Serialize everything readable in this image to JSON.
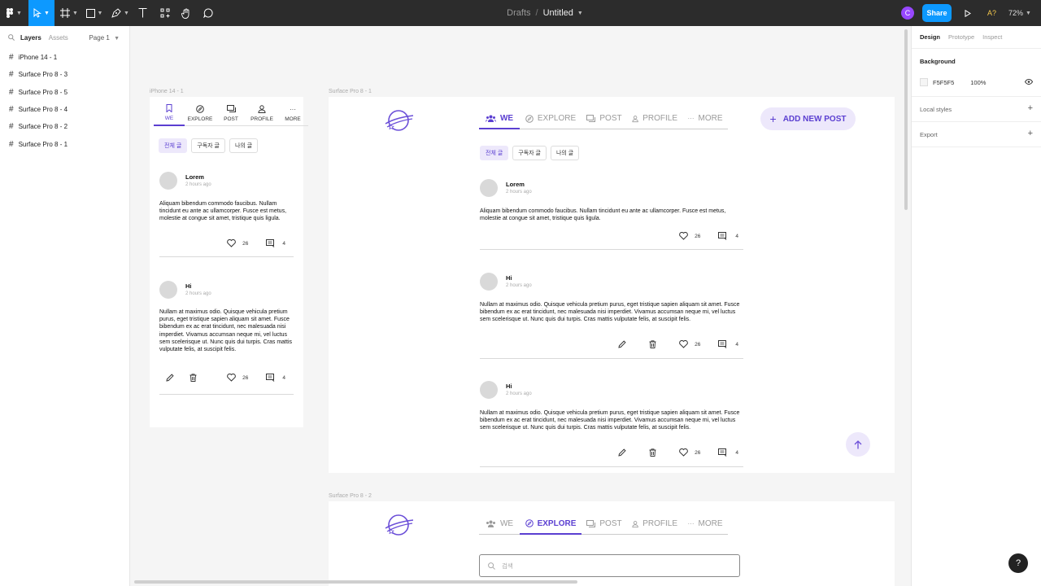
{
  "toolbar": {
    "breadcrumb_root": "Drafts",
    "breadcrumb_sep": "/",
    "file_name": "Untitled",
    "avatar_letter": "C",
    "share_label": "Share",
    "aa_label": "A?",
    "zoom_label": "72%"
  },
  "left_panel": {
    "tab_layers": "Layers",
    "tab_assets": "Assets",
    "page_selector": "Page 1",
    "layers": [
      "iPhone 14 - 1",
      "Surface Pro 8 - 3",
      "Surface Pro 8 - 5",
      "Surface Pro 8 - 4",
      "Surface Pro 8 - 2",
      "Surface Pro 8 - 1"
    ]
  },
  "right_panel": {
    "tab_design": "Design",
    "tab_prototype": "Prototype",
    "tab_inspect": "Inspect",
    "background_title": "Background",
    "background_hex": "F5F5F5",
    "background_opacity": "100%",
    "local_styles": "Local styles",
    "export": "Export"
  },
  "frames": {
    "iphone_label": "iPhone 14 - 1",
    "surface1_label": "Surface Pro 8 - 1",
    "surface2_label": "Surface Pro 8 - 2"
  },
  "nav": {
    "we": "WE",
    "explore": "EXPLORE",
    "post": "POST",
    "profile": "PROFILE",
    "more": "MORE",
    "more_dots": "···"
  },
  "chips": {
    "all": "전체 글",
    "subscribed": "구독자 글",
    "mine": "나의 글"
  },
  "add_post_label": "ADD NEW POST",
  "search_placeholder": "검색",
  "posts": [
    {
      "name": "Lorem",
      "time": "2 hours ago",
      "body": "Aliquam bibendum commodo faucibus. Nullam tincidunt eu ante ac ullamcorper. Fusce est metus, molestie at congue sit amet, tristique quis ligula.",
      "likes": "26",
      "comments": "4"
    },
    {
      "name": "Hi",
      "time": "2 hours ago",
      "body": "Nullam at maximus odio. Quisque vehicula pretium purus, eget tristique sapien aliquam sit amet. Fusce bibendum ex ac erat tincidunt, nec malesuada nisi imperdiet. Vivamus accumsan neque mi, vel luctus sem scelerisque ut. Nunc quis dui turpis. Cras mattis vulputate felis, at suscipit felis.",
      "likes": "26",
      "comments": "4"
    },
    {
      "name": "Hi",
      "time": "2 hours ago",
      "body": "Nullam at maximus odio. Quisque vehicula pretium purus, eget tristique sapien aliquam sit amet. Fusce bibendum ex ac erat tincidunt, nec malesuada nisi imperdiet. Vivamus accumsan neque mi, vel luctus sem scelerisque ut. Nunc quis dui turpis. Cras mattis vulputate felis, at suscipit felis.",
      "likes": "26",
      "comments": "4"
    }
  ],
  "colors": {
    "accent": "#5b3fd1",
    "accent_soft": "#ede8fb",
    "figma_blue": "#0d99ff",
    "toolbar_bg": "#2c2c2c"
  }
}
